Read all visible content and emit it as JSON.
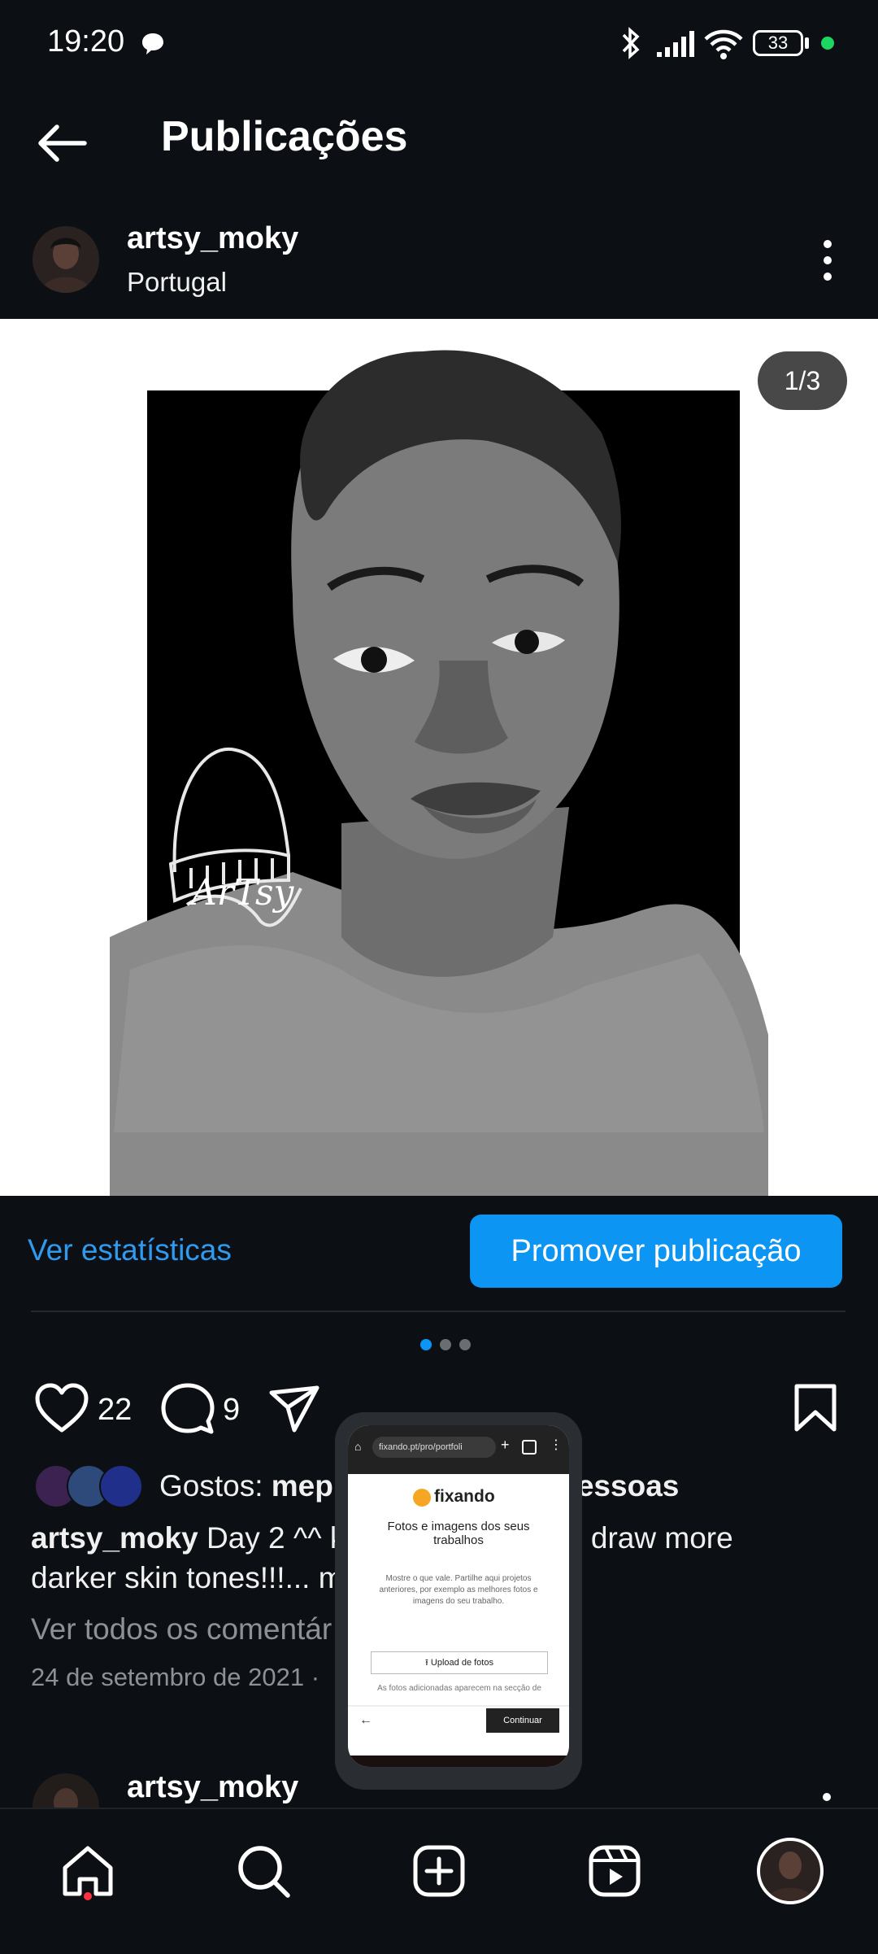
{
  "status_bar": {
    "time": "19:20",
    "battery": "33",
    "icons": [
      "chat-bubble-icon",
      "bluetooth-icon",
      "signal-icon",
      "wifi-icon",
      "battery-icon"
    ]
  },
  "header": {
    "title": "Publicações"
  },
  "post": {
    "username": "artsy_moky",
    "location": "Portugal",
    "carousel_badge": "1/3",
    "signature_text": "ArTsy",
    "insights_label": "Ver estatísticas",
    "promote_label": "Promover publicação",
    "likes_count": "22",
    "comments_count": "9",
    "likes_text_prefix": "Gostos: ",
    "likes_text_user": "mep",
    "likes_text_suffix": "essoas",
    "caption_user": "artsy_moky",
    "caption_part1": " Day 2 ^^ ki",
    "caption_part2": "a try and draw more",
    "caption_line2": "darker skin tones!!!... m",
    "view_comments": "Ver todos os comentár",
    "date": "24 de setembro de 2021  ·"
  },
  "next_post": {
    "username": "artsy_moky"
  },
  "pip": {
    "url": "fixando.pt/pro/portfoli",
    "brand": "fixando",
    "heading": "Fotos e imagens dos seus trabalhos",
    "body": "Mostre o que vale. Partilhe aqui projetos anteriores, por exemplo as melhores fotos e imagens do seu trabalho.",
    "upload_label": "Upload de fotos",
    "footer_note": "As fotos adicionadas aparecem na secção de",
    "continue_label": "Continuar"
  },
  "colors": {
    "accent": "#0c95f3",
    "link": "#2f9bf0",
    "background": "#0c1014"
  }
}
